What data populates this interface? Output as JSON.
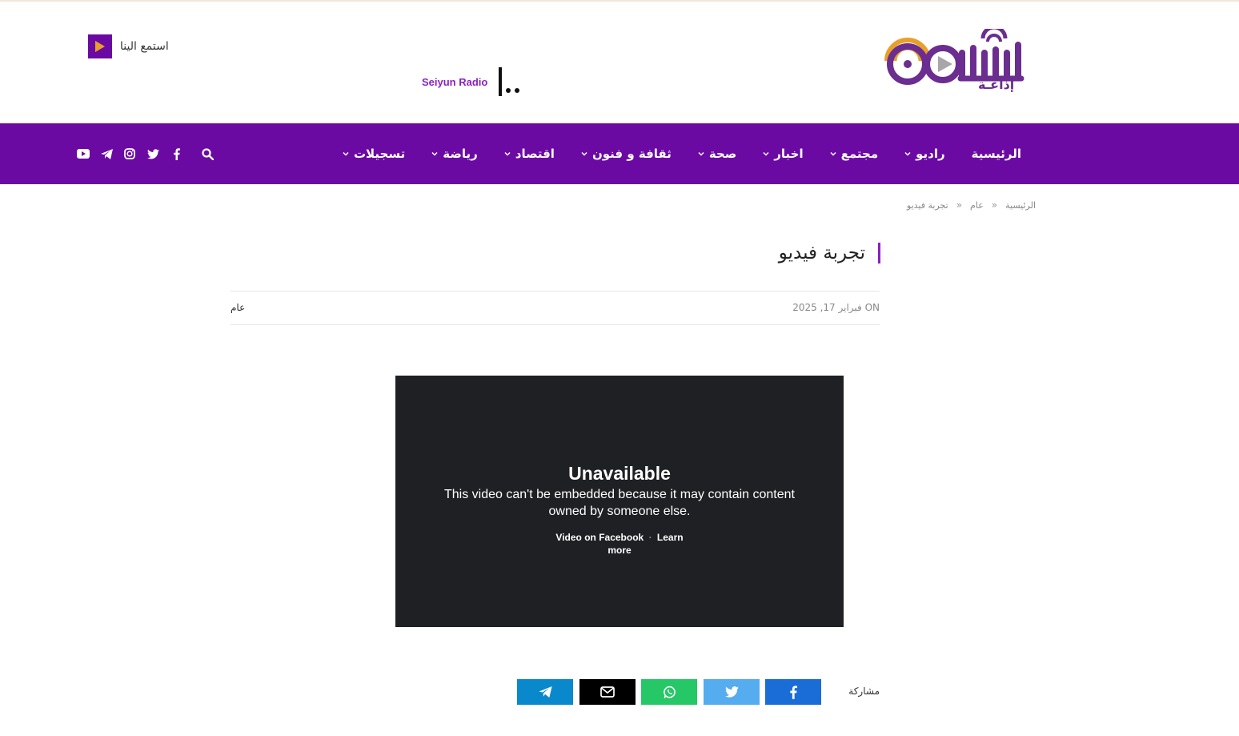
{
  "header": {
    "listen_label": "استمع الينا",
    "ticker_label": "Seiyun Radio"
  },
  "logo": {
    "text": "إذاعـة"
  },
  "nav": {
    "items": [
      {
        "label": "الرئيسية",
        "has_dropdown": false
      },
      {
        "label": "راديو",
        "has_dropdown": true
      },
      {
        "label": "مجتمع",
        "has_dropdown": true
      },
      {
        "label": "اخبار",
        "has_dropdown": true
      },
      {
        "label": "صحة",
        "has_dropdown": true
      },
      {
        "label": "ثقافة و فنون",
        "has_dropdown": true
      },
      {
        "label": "اقتصاد",
        "has_dropdown": true
      },
      {
        "label": "رياضة",
        "has_dropdown": true
      },
      {
        "label": "تسجيلات",
        "has_dropdown": true
      }
    ],
    "icons": [
      "youtube-icon",
      "telegram-icon",
      "instagram-icon",
      "twitter-icon",
      "facebook-icon",
      "search-icon"
    ]
  },
  "breadcrumb": {
    "home": "الرئيسية",
    "category": "عام",
    "current": "تجربة فيديو",
    "separator": "»"
  },
  "post": {
    "title": "تجربة فيديو",
    "date": "ON فبراير 17, 2025",
    "category": "عام"
  },
  "video": {
    "title": "Unavailable",
    "message": "This video can't be embedded because it may contain content owned by someone else.",
    "link_facebook": "Video on Facebook",
    "link_separator": "·",
    "link_learn": "Learn more"
  },
  "share": {
    "label": "مشاركة",
    "buttons": [
      {
        "name": "facebook",
        "color": "#1a6dd6"
      },
      {
        "name": "twitter",
        "color": "#55acee"
      },
      {
        "name": "whatsapp",
        "color": "#26c766"
      },
      {
        "name": "email",
        "color": "#000000"
      },
      {
        "name": "telegram",
        "color": "#0a88cc"
      }
    ]
  },
  "colors": {
    "brand_purple": "#6b0aa3",
    "accent_purple": "#8b1fc4",
    "logo_orange": "#e8a02a",
    "video_bg": "#1f2024"
  }
}
